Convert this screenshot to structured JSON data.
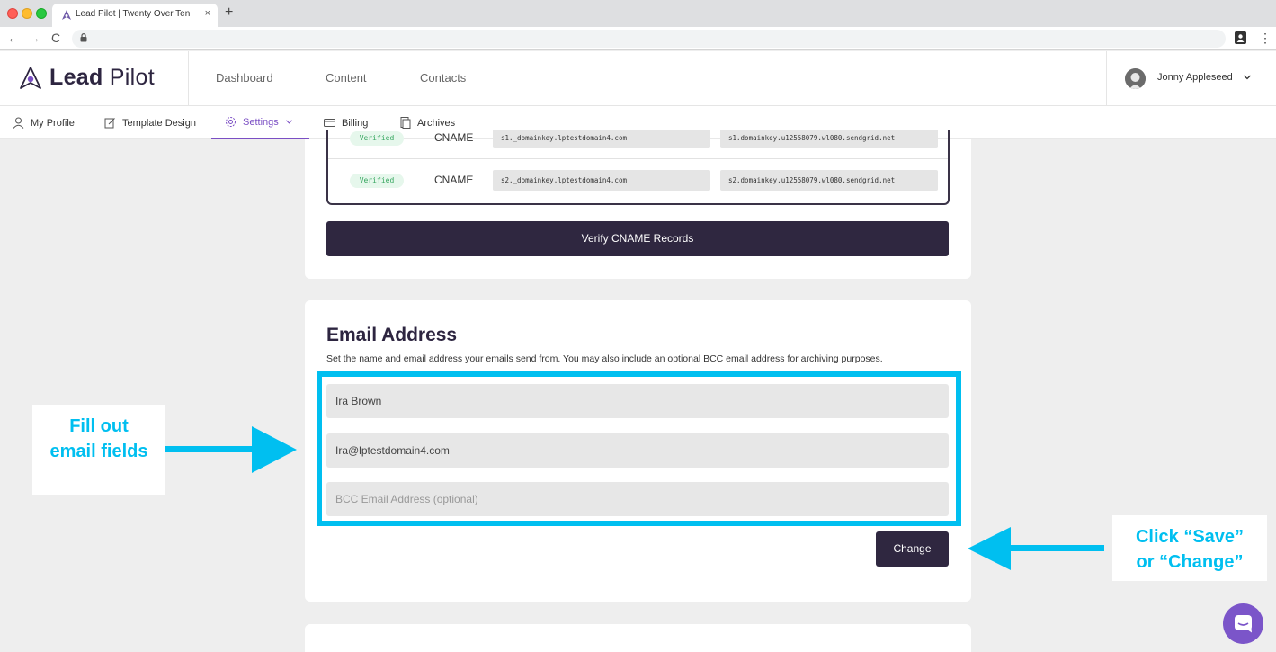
{
  "browser": {
    "tab_title": "Lead Pilot | Twenty Over Ten",
    "close": "×",
    "new_tab": "+",
    "back": "←",
    "forward": "→",
    "reload": "C",
    "menu": "⋮"
  },
  "header": {
    "logo_bold": "Lead",
    "logo_light": " Pilot",
    "nav": [
      "Dashboard",
      "Content",
      "Contacts"
    ],
    "user_name": "Jonny Appleseed"
  },
  "subnav": {
    "items": [
      "My Profile",
      "Template Design",
      "Settings",
      "Billing",
      "Archives"
    ]
  },
  "dns": {
    "rows": [
      {
        "status": "Verified",
        "type": "CNAME",
        "host": "s1._domainkey.lptestdomain4.com",
        "value": "s1.domainkey.u12558079.wl080.sendgrid.net"
      },
      {
        "status": "Verified",
        "type": "CNAME",
        "host": "s2._domainkey.lptestdomain4.com",
        "value": "s2.domainkey.u12558079.wl080.sendgrid.net"
      }
    ],
    "verify_label": "Verify CNAME Records"
  },
  "email": {
    "title": "Email Address",
    "description": "Set the name and email address your emails send from. You may also include an optional BCC email address for archiving purposes.",
    "name_value": "Ira Brown",
    "address_value": "Ira@lptestdomain4.com",
    "bcc_placeholder": "BCC Email Address (optional)",
    "change_label": "Change"
  },
  "annotations": {
    "left_line1": "Fill out",
    "left_line2": "email  fields",
    "right_line1": "Click “Save”",
    "right_line2": "or “Change”",
    "color": "#00bff0"
  },
  "colors": {
    "brand_dark": "#2f2740",
    "accent_purple": "#7b4fc4",
    "verified_green": "#36a65f"
  }
}
